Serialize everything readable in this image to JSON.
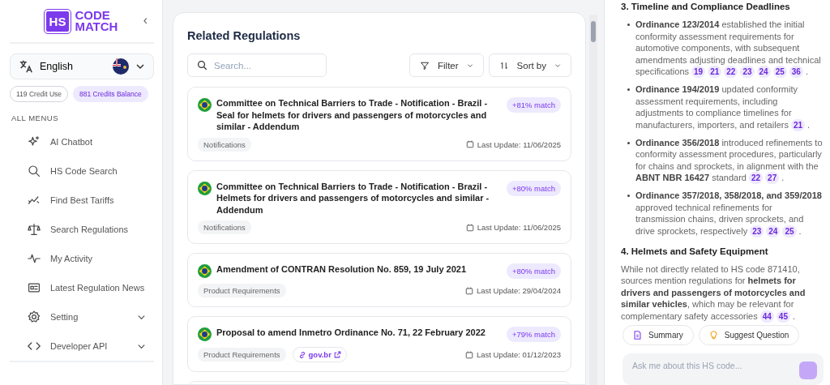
{
  "sidebar": {
    "logo": {
      "badge": "HS",
      "line_1": "CODE",
      "line_2": "MATCH"
    },
    "collapse": "‹",
    "language": {
      "label": "English"
    },
    "credits": [
      {
        "label": "119 Credit Use",
        "kind": "used"
      },
      {
        "label": "881 Credits Balance",
        "kind": "balance"
      }
    ],
    "menu_title": "ALL MENUS",
    "items": [
      {
        "label": "AI Chatbot",
        "kind": "link"
      },
      {
        "label": "HS Code Search",
        "kind": "link"
      },
      {
        "label": "Find Best Tariffs",
        "kind": "link"
      },
      {
        "label": "Search Regulations",
        "kind": "link"
      },
      {
        "label": "My Activity",
        "kind": "link"
      },
      {
        "label": "Latest Regulation News",
        "kind": "link"
      },
      {
        "label": "Setting",
        "kind": "group",
        "expanded": false
      },
      {
        "label": "Developer API",
        "kind": "group",
        "expanded": false
      }
    ]
  },
  "regulations": {
    "title": "Related Regulations",
    "search": {
      "placeholder": "Search..."
    },
    "filter": "Filter",
    "sort": "Sort by",
    "cards": [
      {
        "title": "Committee on Technical Barriers to Trade - Notification - Brazil - Seal for helmets for drivers and passengers of motorcycles and similar - Addendum",
        "match": "+81% match",
        "tag": "Notifications",
        "updated": "Last Update: 11/06/2025"
      },
      {
        "title": "Committee on Technical Barriers to Trade - Notification - Brazil - Helmets for drivers and passengers of motorcycles and similar - Addendum",
        "match": "+80% match",
        "tag": "Notifications",
        "updated": "Last Update: 11/06/2025"
      },
      {
        "title": "Amendment of CONTRAN Resolution No. 859, 19 July 2021",
        "match": "+80% match",
        "tag": "Product Requirements",
        "updated": "Last Update: 29/04/2024"
      },
      {
        "title": "Proposal to amend Inmetro Ordinance No. 71, 22 February 2022",
        "match": "+79% match",
        "tag": "Product Requirements",
        "link": "gov.br",
        "updated": "Last Update: 01/12/2023"
      }
    ]
  },
  "chat": {
    "sections": [
      {
        "heading": "3. Timeline and Compliance Deadlines",
        "bullets": [
          {
            "text": "**Ordinance 123/2014** established the initial conformity assessment requirements for automotive components, with subsequent amendments adjusting deadlines and technical specifications",
            "citations": [
              "19",
              "21",
              "22",
              "23",
              "24",
              "25",
              "36"
            ],
            "end": "."
          },
          {
            "text": "**Ordinance 194/2019** updated conformity assessment requirements, including adjustments to compliance timelines for manufacturers, importers, and retailers",
            "citations": [
              "21"
            ],
            "end": "."
          },
          {
            "text": "**Ordinance 356/2018** introduced refinements to conformity assessment procedures, particularly for chains and sprockets, in alignment with the **ABNT NBR 16427** standard",
            "citations": [
              "22",
              "27"
            ],
            "end": "."
          },
          {
            "text": "**Ordinance 357/2018, 358/2018, and 359/2018** approved technical refinements for transmission chains, driven sprockets, and drive sprockets, respectively",
            "citations": [
              "23",
              "24",
              "25"
            ],
            "end": "."
          }
        ]
      },
      {
        "heading": "4. Helmets and Safety Equipment",
        "paragraphs": [
          {
            "text": "While not directly related to HS code 871410, sources mention regulations for **helmets for drivers and passengers of motorcycles and similar vehicles**, which may be relevant for complementary safety accessories",
            "citations": [
              "44",
              "45"
            ],
            "end": "."
          }
        ]
      }
    ],
    "actions": [
      "Summary",
      "Suggest Question"
    ],
    "input": {
      "placeholder": "Ask me about this HS code..."
    }
  }
}
